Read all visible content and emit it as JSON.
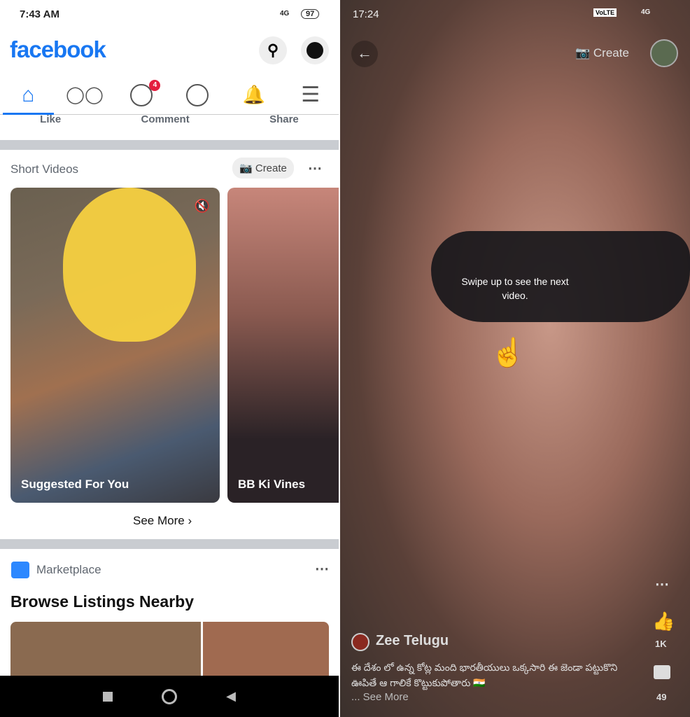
{
  "left": {
    "status_time": "7:43 AM",
    "battery": "97",
    "network": "4G",
    "logo": "facebook",
    "nav": {
      "groups_badge": "4"
    },
    "post_actions": [
      "Like",
      "Comment",
      "Share"
    ],
    "short_videos": {
      "title": "Short Videos",
      "create_label": "Create",
      "cards": [
        "Suggested For You",
        "BB Ki Vines"
      ],
      "see_more": "See More"
    },
    "marketplace": {
      "title": "Marketplace",
      "heading": "Browse Listings Nearby"
    },
    "accent": "#1877f2"
  },
  "right": {
    "status_time": "17:24",
    "volte": "VoLTE",
    "network": "4G",
    "create_label": "Create",
    "hint": "Swipe up to see the next video.",
    "channel": "Zee Telugu",
    "caption": "ఈ దేశం లో ఉన్న కోట్ల మంది భారతీయులు ఒక్కసారి ఈ జెండా పట్టుకొని ఊపితే ఆ గాలికే కొట్టుకుపోతారు 🇮🇳",
    "see_more": "... See More",
    "likes": "1K",
    "comments": "49"
  }
}
